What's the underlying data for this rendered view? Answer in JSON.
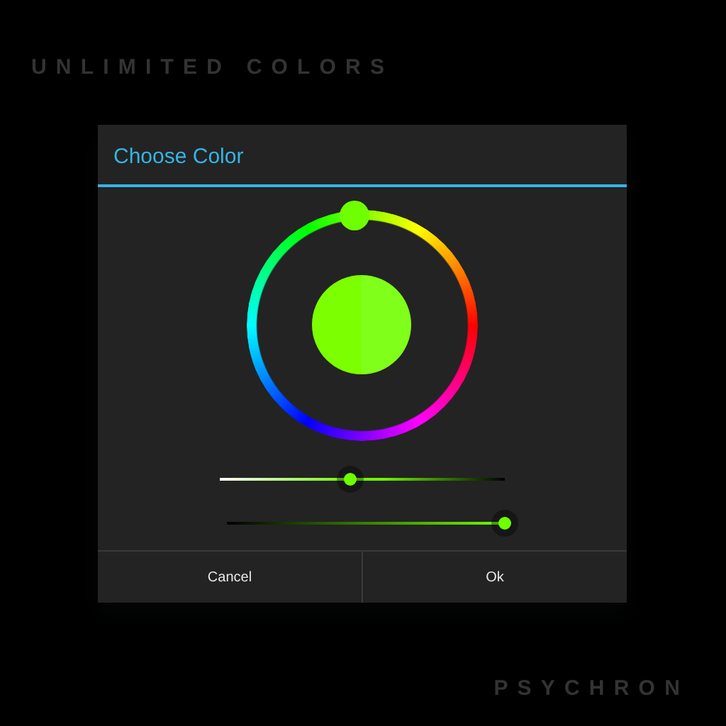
{
  "header_logo": "UNLIMITED COLORS",
  "dialog": {
    "title": "Choose Color",
    "preview_halves": [
      {
        "color": "#7cff00"
      },
      {
        "color": "#80ff1a"
      }
    ],
    "sliders": [
      {
        "kind": "saturation",
        "level": 0.46
      },
      {
        "kind": "value",
        "level": 1
      }
    ],
    "buttons": [
      "Cancel",
      "Ok"
    ]
  },
  "footer_logo": "PSYCHRON"
}
